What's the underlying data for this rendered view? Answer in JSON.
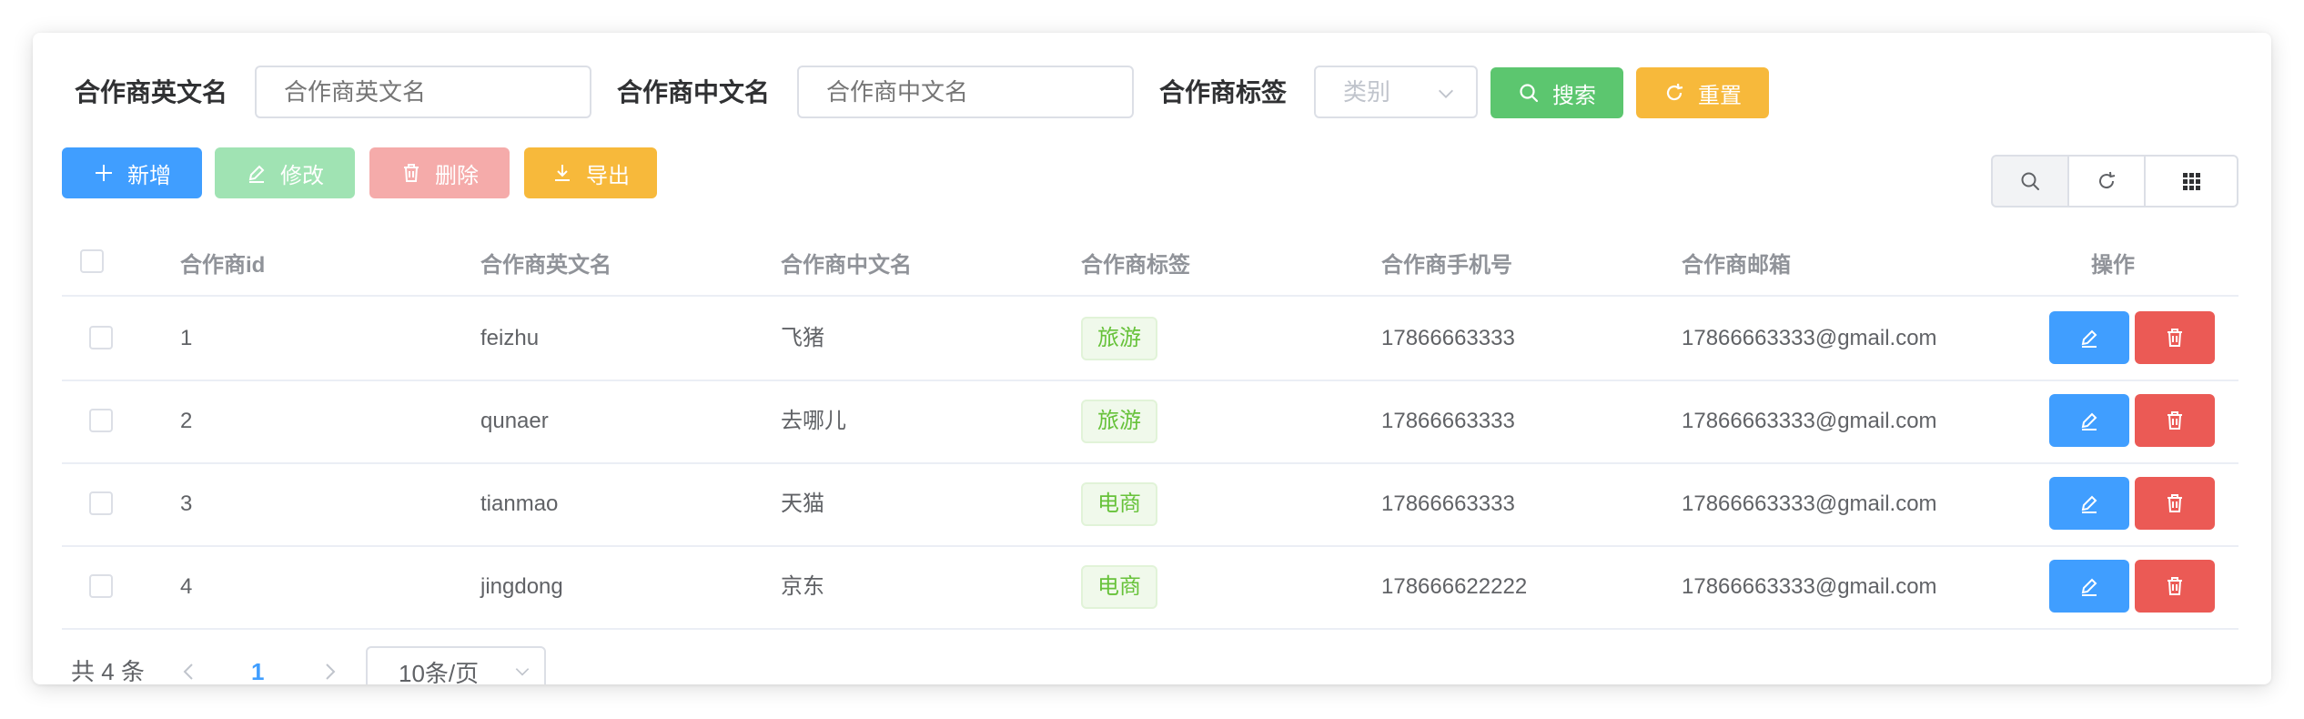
{
  "search": {
    "en_label": "合作商英文名",
    "en_placeholder": "合作商英文名",
    "cn_label": "合作商中文名",
    "cn_placeholder": "合作商中文名",
    "tag_label": "合作商标签",
    "tag_placeholder": "类别",
    "search_button": "搜索",
    "reset_button": "重置"
  },
  "toolbar": {
    "add": "新增",
    "edit": "修改",
    "delete": "删除",
    "export": "导出"
  },
  "table": {
    "headers": [
      "合作商id",
      "合作商英文名",
      "合作商中文名",
      "合作商标签",
      "合作商手机号",
      "合作商邮箱",
      "操作"
    ],
    "rows": [
      {
        "id": "1",
        "en": "feizhu",
        "cn": "飞猪",
        "tag": "旅游",
        "phone": "17866663333",
        "email": "17866663333@gmail.com"
      },
      {
        "id": "2",
        "en": "qunaer",
        "cn": "去哪儿",
        "tag": "旅游",
        "phone": "17866663333",
        "email": "17866663333@gmail.com"
      },
      {
        "id": "3",
        "en": "tianmao",
        "cn": "天猫",
        "tag": "电商",
        "phone": "17866663333",
        "email": "17866663333@gmail.com"
      },
      {
        "id": "4",
        "en": "jingdong",
        "cn": "京东",
        "tag": "电商",
        "phone": "178666622222",
        "email": "17866663333@gmail.com"
      }
    ]
  },
  "pagination": {
    "total": "共 4 条",
    "current_page": "1",
    "page_size": "10条/页"
  },
  "colors": {
    "primary": "#409eff",
    "success": "#5cc66f",
    "warning": "#f7b93b",
    "danger": "#eb5a55"
  }
}
